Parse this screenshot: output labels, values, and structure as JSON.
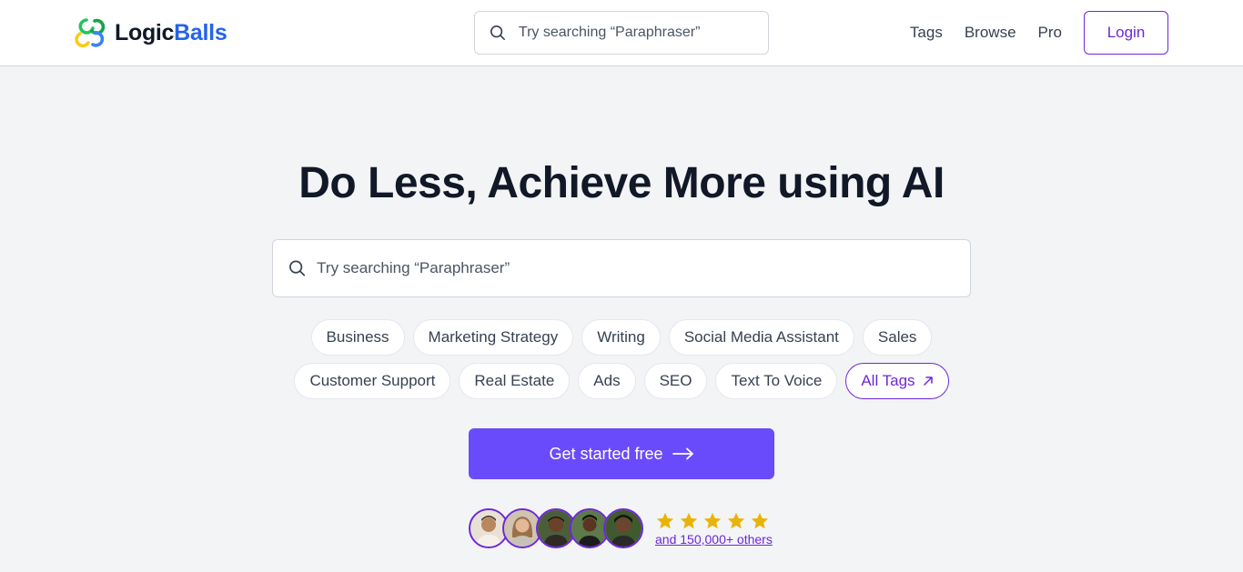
{
  "header": {
    "logo": {
      "text_part1": "Logic",
      "text_part2": "Balls",
      "icon": "logicballs-logo-icon"
    },
    "search": {
      "placeholder": "Try searching “Paraphraser”",
      "icon": "search-icon"
    },
    "nav": [
      {
        "label": "Tags"
      },
      {
        "label": "Browse"
      },
      {
        "label": "Pro"
      }
    ],
    "login_label": "Login"
  },
  "hero": {
    "title": "Do Less, Achieve More using AI",
    "search": {
      "placeholder": "Try searching “Paraphraser”",
      "icon": "search-icon"
    },
    "tags_row1": [
      "Business",
      "Marketing Strategy",
      "Writing",
      "Social Media Assistant",
      "Sales"
    ],
    "tags_row2": [
      "Customer Support",
      "Real Estate",
      "Ads",
      "SEO",
      "Text To Voice"
    ],
    "all_tags_label": "All Tags",
    "cta_label": "Get started free",
    "social_proof": {
      "avatar_count": 5,
      "stars": 5,
      "others_label": "and 150,000+ others"
    }
  },
  "colors": {
    "accent": "#6d28d9",
    "cta_bg": "#6a4bfc",
    "star": "#eab308",
    "logo_blue": "#2563eb",
    "page_bg": "#f3f4f6"
  }
}
